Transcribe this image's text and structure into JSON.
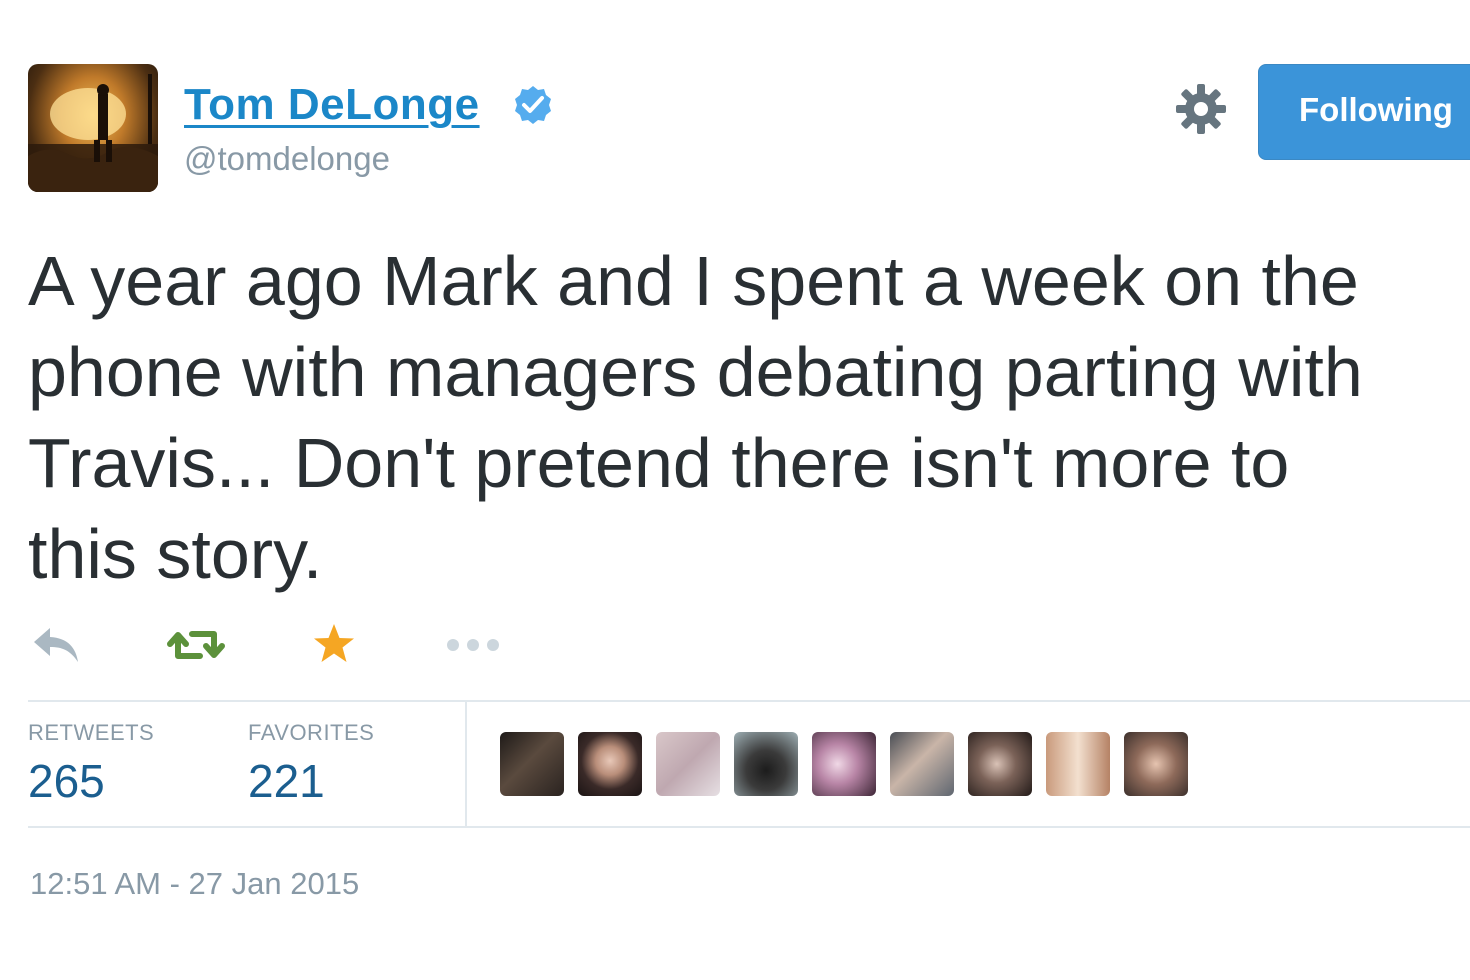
{
  "user": {
    "name": "Tom DeLonge",
    "handle": "@tomdelonge",
    "verified": true
  },
  "follow_button": {
    "label": "Following"
  },
  "tweet": {
    "lines": [
      "A year ago Mark and I spent a week on the",
      "phone with managers debating parting with",
      "Travis... Don't pretend there isn't more to",
      "this story."
    ]
  },
  "actions": {
    "icons": [
      "reply-icon",
      "retweet-icon",
      "favorite-icon",
      "more-icon"
    ],
    "favorited": true
  },
  "stats": {
    "retweets_label": "RETWEETS",
    "retweets_count": "265",
    "favorites_label": "FAVORITES",
    "favorites_count": "221"
  },
  "timestamp": "12:51 AM - 27 Jan 2015",
  "colors": {
    "link_blue": "#1b87c8",
    "button_blue": "#3b94d9",
    "retweet_green": "#19cf86",
    "favorite_orange": "#ffac33",
    "muted_gray": "#8899a6"
  }
}
